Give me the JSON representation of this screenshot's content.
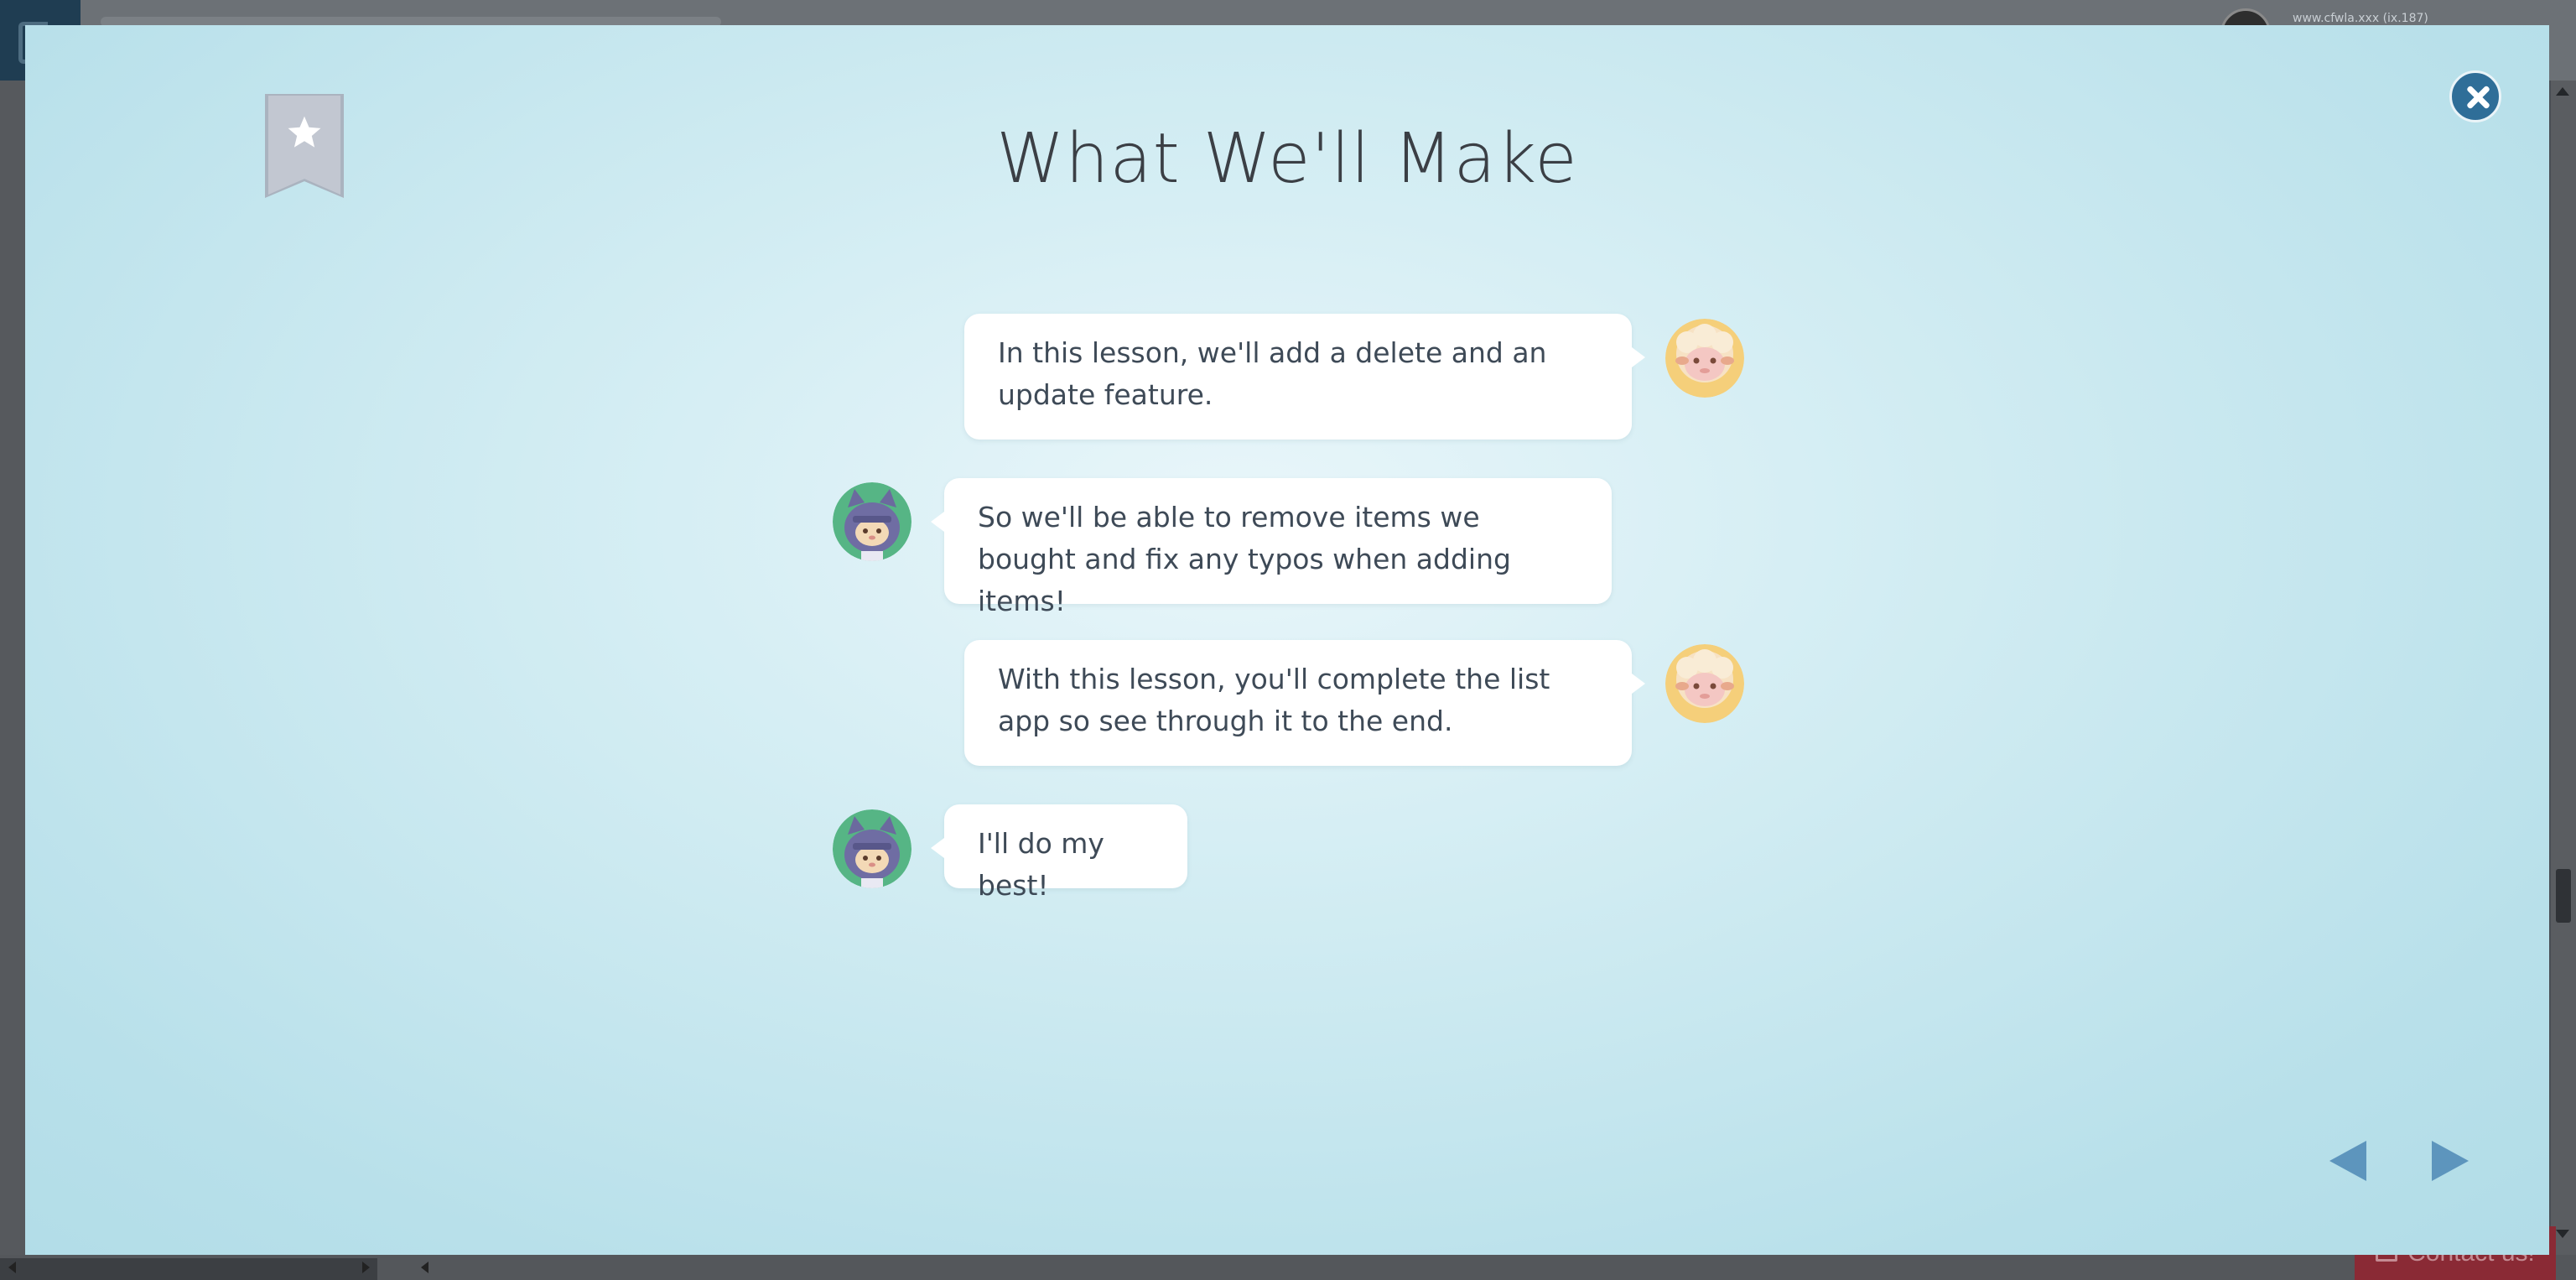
{
  "background": {
    "user_text": "www.cfwla.xxx (ix.187)",
    "contact_label": "Contact us!"
  },
  "modal": {
    "title": "What We'll Make",
    "messages": [
      {
        "speaker": "sheep",
        "side": "right",
        "text": "In this lesson, we'll add a delete and an update feature."
      },
      {
        "speaker": "ninja-cat",
        "side": "left",
        "text": "So we'll be able to remove items we bought and fix any typos when adding items!"
      },
      {
        "speaker": "sheep",
        "side": "right",
        "text": "With this lesson, you'll complete the list app so see through it to the end."
      },
      {
        "speaker": "ninja-cat",
        "side": "left",
        "text": "I'll do my best!"
      }
    ],
    "icons": {
      "bookmark": "bookmark-star-icon",
      "close": "close-icon",
      "prev": "arrow-left-icon",
      "next": "arrow-right-icon"
    },
    "colors": {
      "accent": "#2f6e98",
      "nav_arrow": "#5d95bd",
      "text": "#3e4a57",
      "bubble": "#ffffff"
    }
  }
}
